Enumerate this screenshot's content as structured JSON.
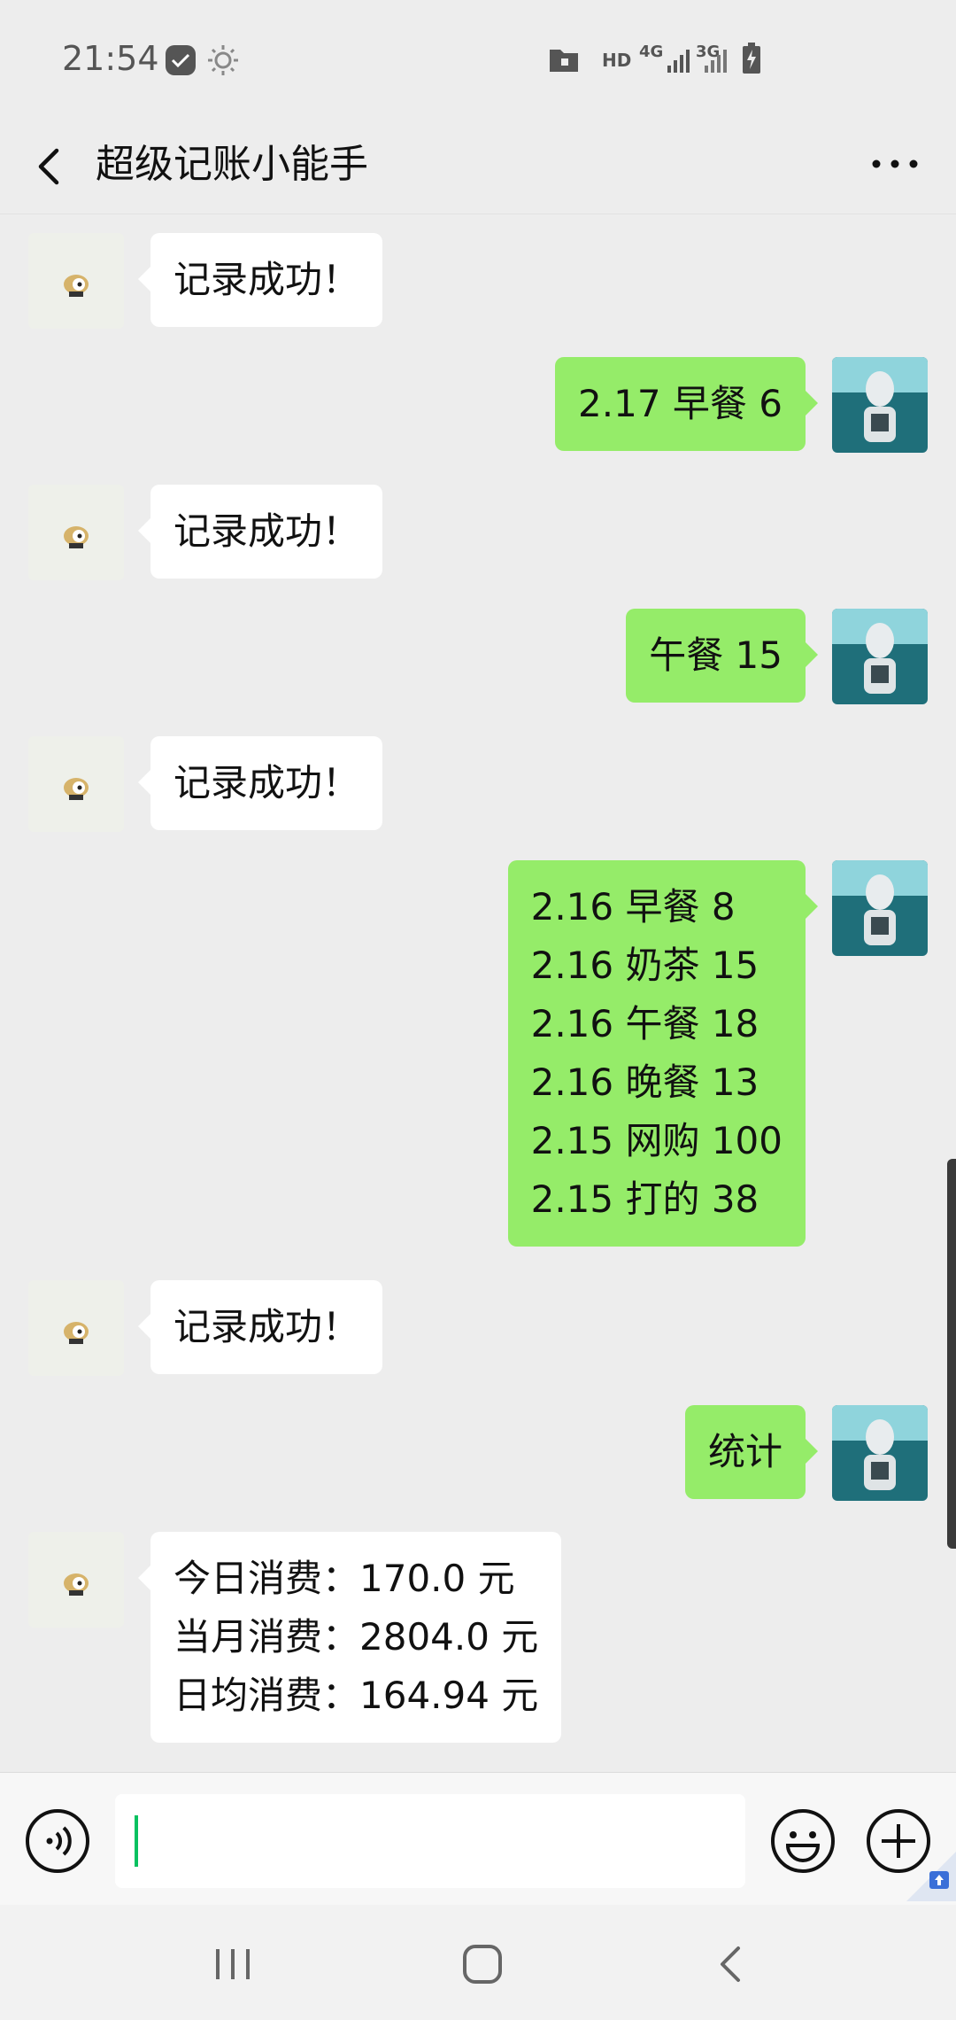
{
  "status_bar": {
    "time": "21:54",
    "network_labels": [
      "HD",
      "4G",
      "3G"
    ]
  },
  "header": {
    "title": "超级记账小能手"
  },
  "messages": [
    {
      "side": "left",
      "lines": [
        "记录成功！"
      ]
    },
    {
      "side": "right",
      "lines": [
        "2.17 早餐 6"
      ]
    },
    {
      "side": "left",
      "lines": [
        "记录成功！"
      ]
    },
    {
      "side": "right",
      "lines": [
        "午餐 15"
      ]
    },
    {
      "side": "left",
      "lines": [
        "记录成功！"
      ]
    },
    {
      "side": "right",
      "lines": [
        "2.16 早餐 8",
        "2.16 奶茶 15",
        "2.16 午餐 18",
        "2.16 晚餐 13",
        "2.15 网购 100",
        "2.15 打的 38"
      ]
    },
    {
      "side": "left",
      "lines": [
        "记录成功！"
      ]
    },
    {
      "side": "right",
      "lines": [
        "统计"
      ]
    },
    {
      "side": "left",
      "lines": [
        "今日消费：170.0 元",
        "当月消费：2804.0 元",
        "日均消费：164.94 元"
      ]
    }
  ],
  "input": {
    "value": ""
  },
  "icons": {
    "back": "chevron-left-icon",
    "more": "more-dots-icon",
    "voice": "voice-icon",
    "emoji": "emoji-icon",
    "plus": "plus-icon",
    "nav_recents": "recents-icon",
    "nav_home": "home-icon",
    "nav_back": "back-icon"
  },
  "colors": {
    "sent_bubble": "#95ec69",
    "received_bubble": "#ffffff",
    "background": "#ededed",
    "caret": "#07c160"
  }
}
